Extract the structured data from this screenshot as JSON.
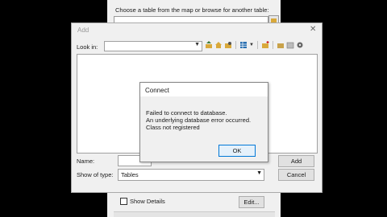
{
  "background_window": {
    "prompt": "Choose a table from the map or browse for another table:",
    "show_details_label": "Show Details",
    "edit_label": "Edit..."
  },
  "add_dialog": {
    "title": "Add",
    "close_glyph": "✕",
    "look_in_label": "Look in:",
    "look_in_value": "",
    "name_label": "Name:",
    "name_value": "",
    "show_type_label": "Show of type:",
    "show_type_value": "Tables",
    "add_label": "Add",
    "cancel_label": "Cancel",
    "toolbar_icons": [
      "up-folder-icon",
      "home-icon",
      "connect-folder-icon",
      "grid-view-icon",
      "new-folder-icon",
      "catalog-icon",
      "tools-icon"
    ]
  },
  "connect_dialog": {
    "title": "Connect",
    "message_line1": "Failed to connect to database.",
    "message_line2": "An underlying database error occurred.",
    "message_line3": "Class not registered",
    "ok_label": "OK"
  }
}
